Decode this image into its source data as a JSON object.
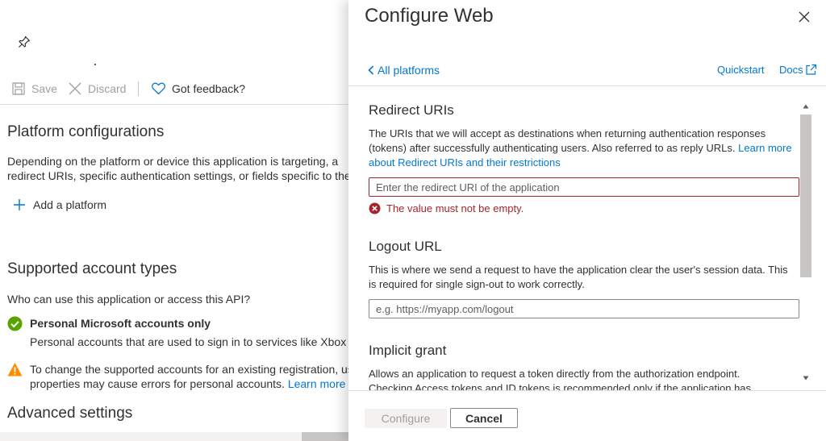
{
  "background": {
    "icons": {
      "pin": "pin-icon",
      "save": "save-icon",
      "discard": "close-icon",
      "feedback": "heart-icon",
      "add": "plus-icon",
      "check": "checkmark-circle-icon",
      "warning": "warning-icon"
    },
    "toolbar": {
      "save_label": "Save",
      "discard_label": "Discard",
      "feedback_label": "Got feedback?"
    },
    "platform": {
      "title": "Platform configurations",
      "desc_line1": "Depending on the platform or device this application is targeting, a",
      "desc_line2": "redirect URIs, specific authentication settings, or fields specific to the pla",
      "add_label": "Add a platform"
    },
    "accounts": {
      "title": "Supported account types",
      "question": "Who can use this application or access this API?",
      "selected_label": "Personal Microsoft accounts only",
      "selected_desc": "Personal accounts that are used to sign in to services like Xbox and",
      "warning_line1": "To change the supported accounts for an existing registration, use",
      "warning_line2": "properties may cause errors for personal accounts.",
      "warning_link": "Learn more abo"
    },
    "advanced": {
      "title": "Advanced settings"
    }
  },
  "panel": {
    "title": "Configure Web",
    "back_label": "All platforms",
    "quickstart_label": "Quickstart",
    "docs_label": "Docs",
    "icons": {
      "close": "close-icon",
      "back": "chevron-left-icon",
      "docs": "external-link-icon",
      "error": "error-circle-icon",
      "scroll_up": "caret-up-icon",
      "scroll_down": "caret-down-icon"
    },
    "redirect": {
      "title": "Redirect URIs",
      "desc_line1": "The URIs that we will accept as destinations when returning authentication responses",
      "desc_line2_text": "(tokens) after successfully authenticating users. Also referred to as reply URLs.",
      "desc_line2_link": "Learn more",
      "desc_line3_link": "about Redirect URIs and their restrictions",
      "input_value": "",
      "input_placeholder": "Enter the redirect URI of the application",
      "error_text": "The value must not be empty."
    },
    "logout": {
      "title": "Logout URL",
      "desc_line1": "This is where we send a request to have the application clear the user's session data. This",
      "desc_line2": "is required for single sign-out to work correctly.",
      "input_value": "",
      "input_placeholder": "e.g. https://myapp.com/logout"
    },
    "implicit": {
      "title": "Implicit grant",
      "desc_line1": "Allows an application to request a token directly from the authorization endpoint.",
      "desc_line2": "Checking Access tokens and ID tokens is recommended only if the application has"
    },
    "footer": {
      "configure_label": "Configure",
      "cancel_label": "Cancel"
    },
    "colors": {
      "accent": "#0078d4",
      "error": "#a4262c",
      "success": "#107c10",
      "warning": "#ffaa44"
    }
  }
}
